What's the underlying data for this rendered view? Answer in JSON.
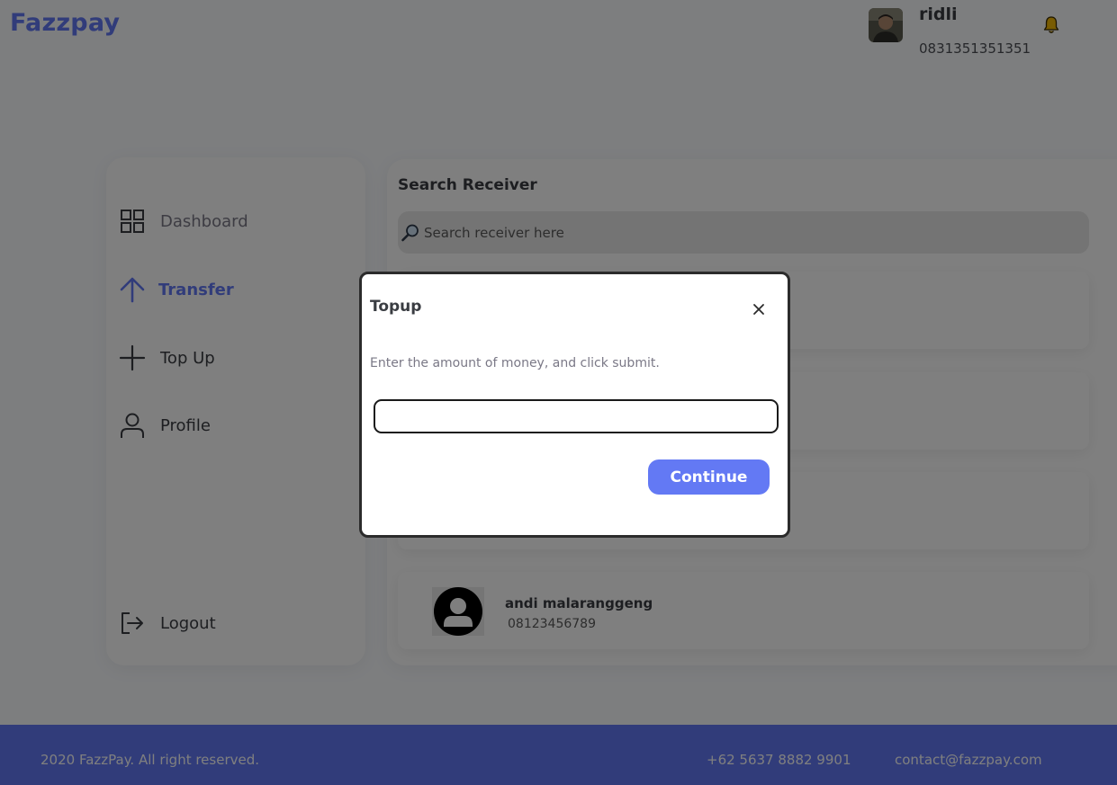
{
  "header": {
    "brand": "Fazzpay",
    "user_name": "ridli",
    "user_phone": "0831351351351"
  },
  "sidebar": {
    "items": [
      {
        "label": "Dashboard",
        "icon": "grid-icon"
      },
      {
        "label": "Transfer",
        "icon": "arrow-up-icon"
      },
      {
        "label": "Top Up",
        "icon": "plus-icon"
      },
      {
        "label": "Profile",
        "icon": "user-icon"
      }
    ],
    "logout_label": "Logout"
  },
  "main": {
    "title": "Search Receiver",
    "search_placeholder": "Search receiver here",
    "receivers": [
      {
        "name": "andi malaranggeng",
        "phone": "08123456789"
      }
    ]
  },
  "modal": {
    "title": "Topup",
    "description": "Enter the amount of money, and click submit.",
    "input_value": "",
    "button_label": "Continue"
  },
  "footer": {
    "copyright": "2020 FazzPay. All right reserved.",
    "phone": "+62 5637 8882 9901",
    "email": "contact@fazzpay.com"
  },
  "colors": {
    "accent": "#6379f4",
    "text": "#3a3d42",
    "overlay": "rgba(0,0,0,0.5)"
  }
}
